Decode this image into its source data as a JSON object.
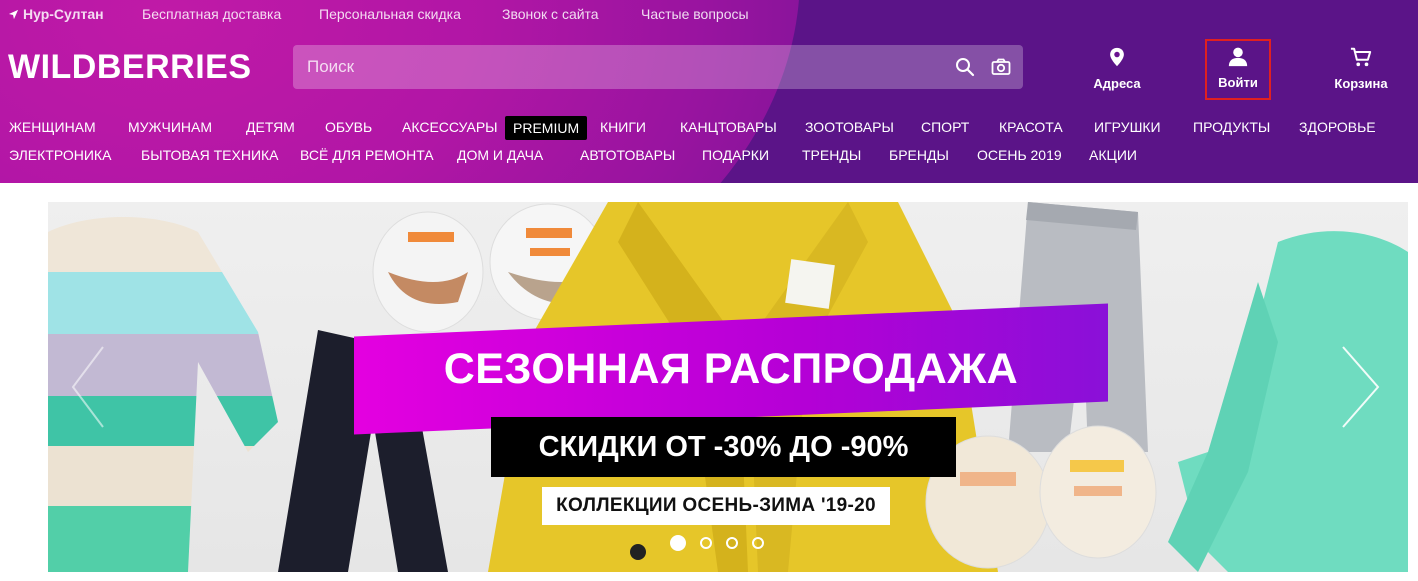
{
  "topbar": {
    "city": "Нур-Султан",
    "links": [
      "Бесплатная доставка",
      "Персональная скидка",
      "Звонок с сайта",
      "Частые вопросы"
    ]
  },
  "logo": "WILDBERRIES",
  "search": {
    "placeholder": "Поиск",
    "value": ""
  },
  "header_buttons": {
    "address": "Адреса",
    "login": "Войти",
    "cart": "Корзина"
  },
  "nav_row1": [
    "ЖЕНЩИНАМ",
    "МУЖЧИНАМ",
    "ДЕТЯМ",
    "ОБУВЬ",
    "АКСЕССУАРЫ",
    "PREMIUM",
    "КНИГИ",
    "КАНЦТОВАРЫ",
    "ЗООТОВАРЫ",
    "СПОРТ",
    "КРАСОТА",
    "ИГРУШКИ",
    "ПРОДУКТЫ",
    "ЗДОРОВЬЕ"
  ],
  "nav_row2": [
    "ЭЛЕКТРОНИКА",
    "БЫТОВАЯ ТЕХНИКА",
    "ВСЁ ДЛЯ РЕМОНТА",
    "ДОМ И ДАЧА",
    "АВТОТОВАРЫ",
    "ПОДАРКИ",
    "ТРЕНДЫ",
    "БРЕНДЫ",
    "ОСЕНЬ 2019",
    "АКЦИИ"
  ],
  "banner": {
    "headline": "СЕЗОННАЯ РАСПРОДАЖА",
    "discount": "СКИДКИ ОТ -30% ДО -90%",
    "collection": "КОЛЛЕКЦИИ ОСЕНЬ-ЗИМА '19-20",
    "slide_count": 4,
    "active_slide": 1
  },
  "colors": {
    "header_purple": "#5b1488",
    "header_magenta": "#c21aa8",
    "promo_magenta": "#e400e0",
    "login_highlight": "#e02020"
  }
}
